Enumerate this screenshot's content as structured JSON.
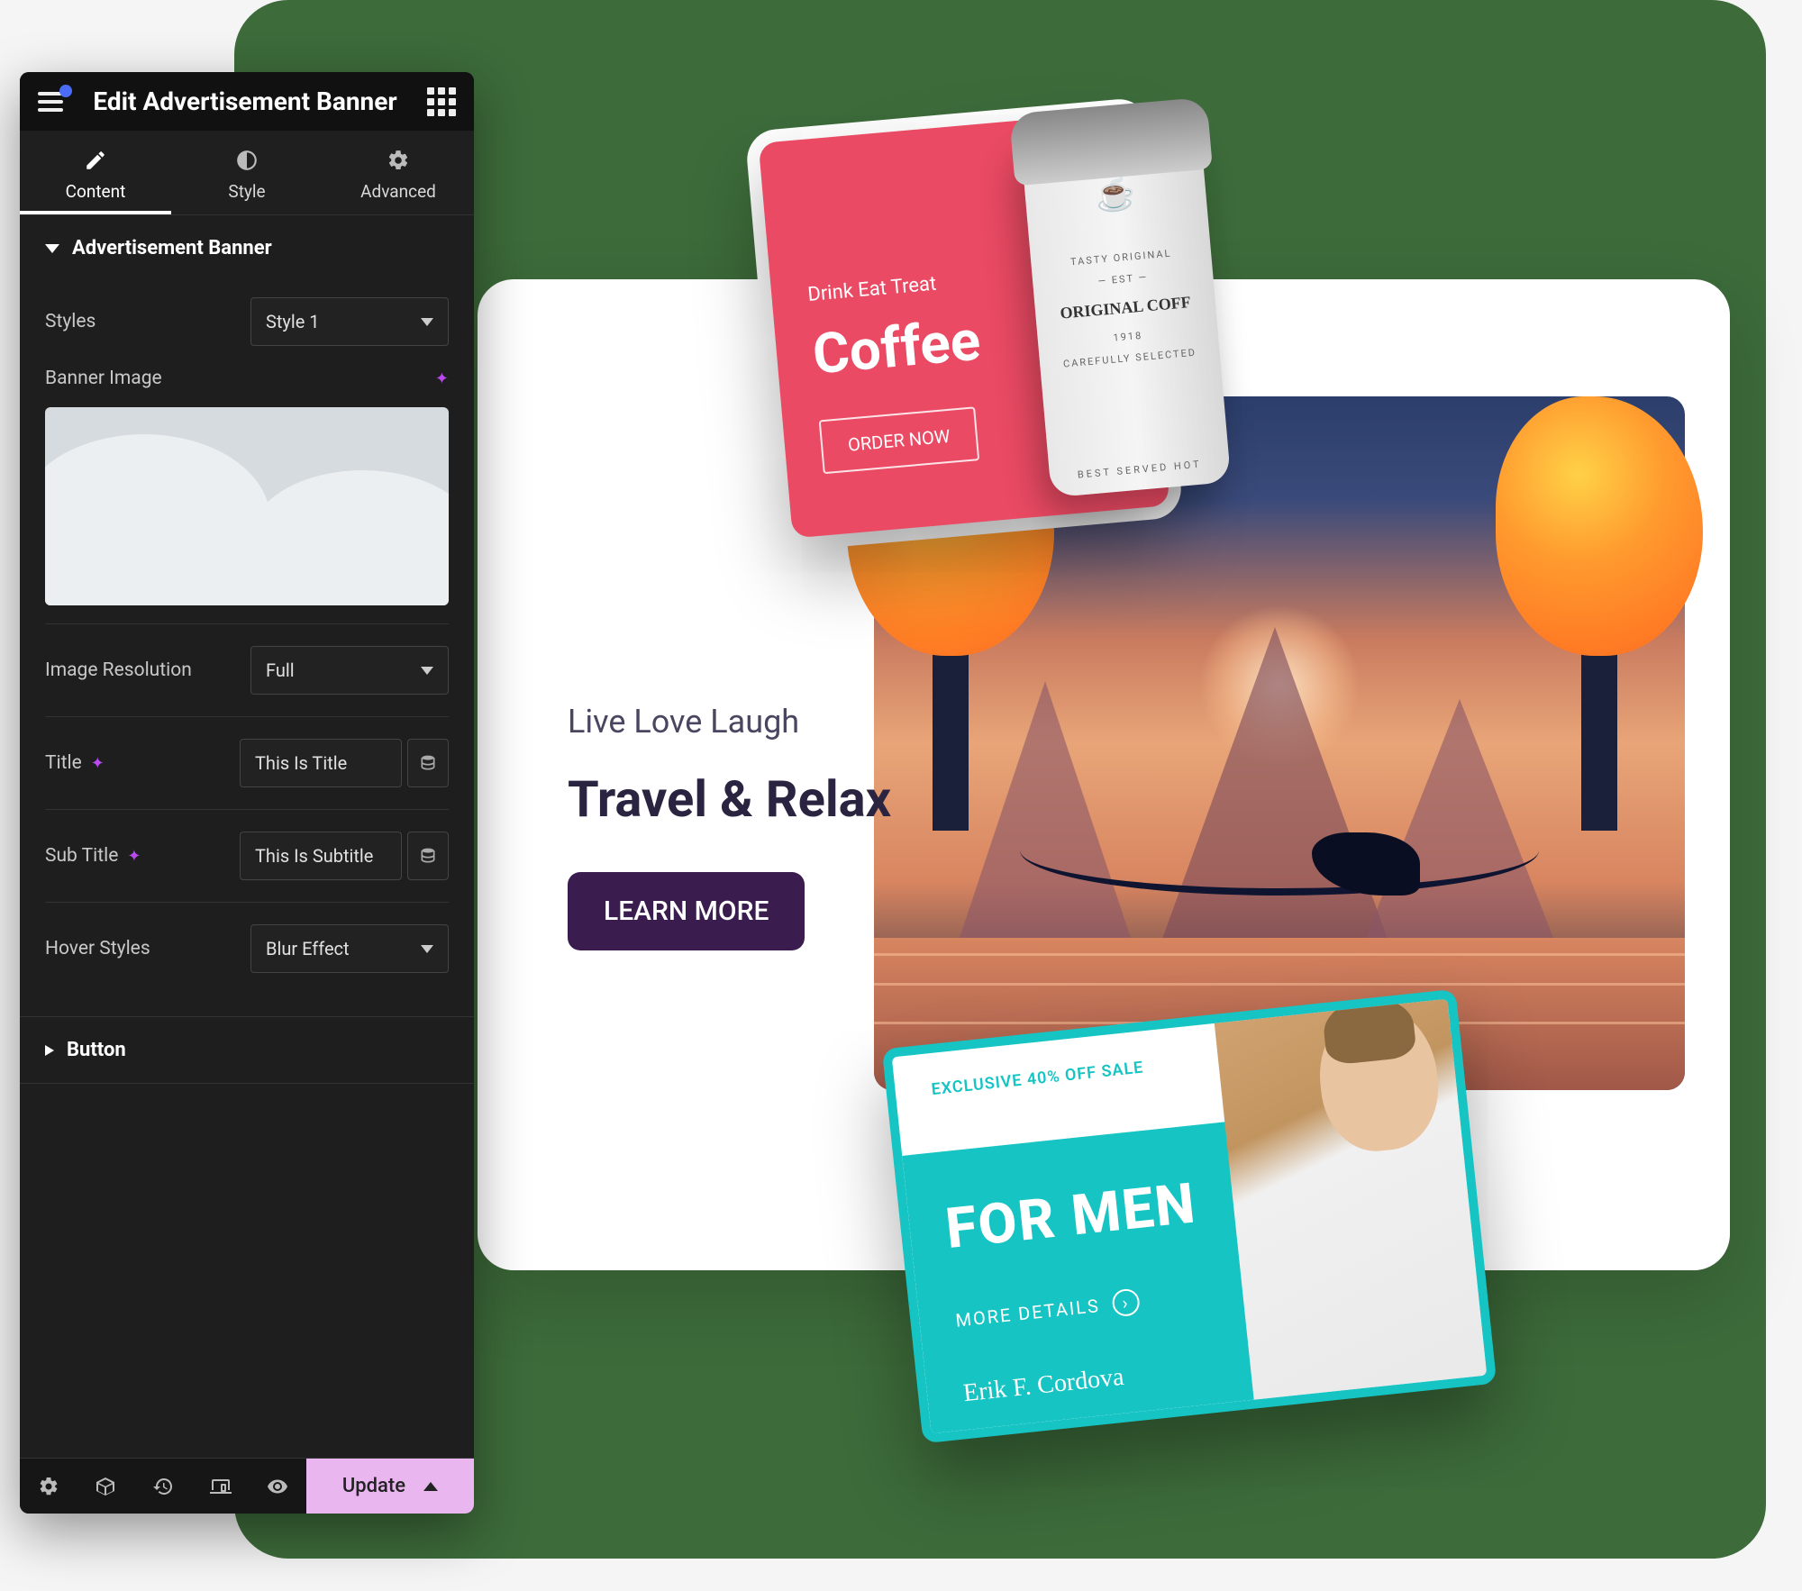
{
  "editor": {
    "title": "Edit Advertisement Banner",
    "tabs": {
      "content": "Content",
      "style": "Style",
      "advanced": "Advanced"
    },
    "section_banner": "Advertisement Banner",
    "section_button": "Button",
    "fields": {
      "styles_label": "Styles",
      "styles_value": "Style 1",
      "banner_image_label": "Banner Image",
      "resolution_label": "Image Resolution",
      "resolution_value": "Full",
      "title_label": "Title",
      "title_value": "This Is Title",
      "subtitle_label": "Sub Title",
      "subtitle_value": "This Is Subtitle",
      "hover_label": "Hover Styles",
      "hover_value": "Blur Effect"
    },
    "update": "Update"
  },
  "hero": {
    "sub": "Live Love Laugh",
    "title": "Travel & Relax",
    "cta": "LEARN MORE"
  },
  "coffee": {
    "sub": "Drink Eat Treat",
    "title": "Coffee",
    "cta": "ORDER NOW",
    "cup_tag1": "TASTY ORIGINAL",
    "cup_est": "EST",
    "cup_brand": "ORIGINAL COFF",
    "cup_year": "1918",
    "cup_tag2": "CAREFULLY SELECTED",
    "cup_bottom": "BEST SERVED HOT"
  },
  "men": {
    "sub": "EXCLUSIVE 40% OFF SALE",
    "title": "FOR MEN",
    "cta": "MORE DETAILS",
    "sig": "Erik F. Cordova"
  }
}
